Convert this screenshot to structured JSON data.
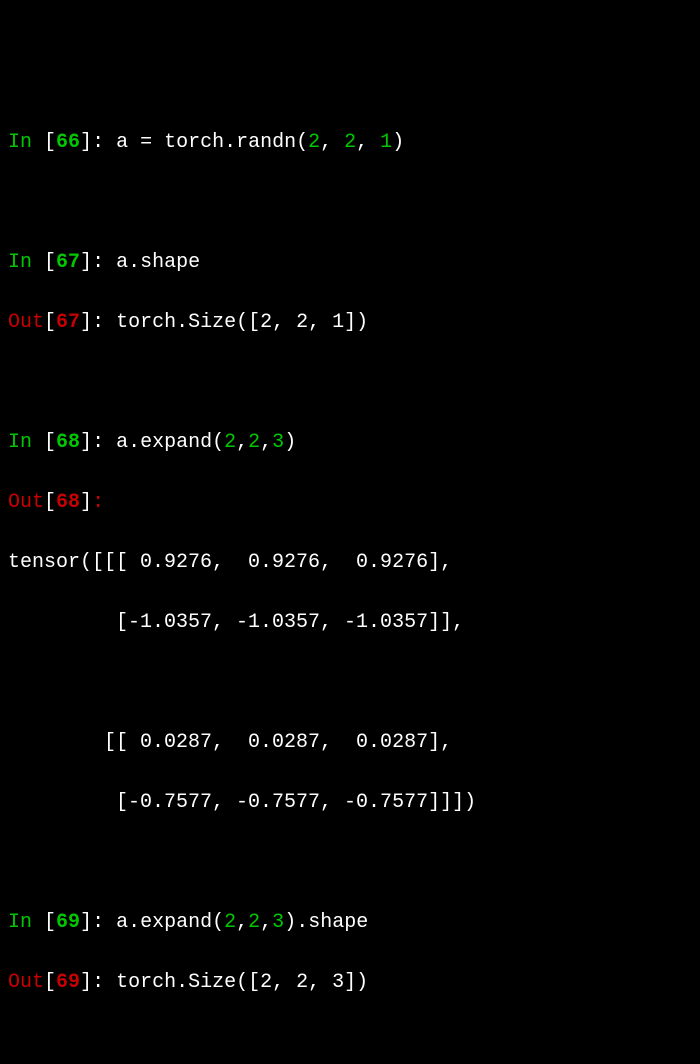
{
  "cells": [
    {
      "in_num": "66",
      "in_prefix": "In ",
      "out_prefix": "Out",
      "code_parts": [
        "a = torch.randn(",
        "2",
        ", ",
        "2",
        ", ",
        "1",
        ")"
      ]
    },
    {
      "in_num": "67",
      "code": "a.shape",
      "out_num": "67",
      "output": "torch.Size([2, 2, 1])"
    },
    {
      "in_num": "68",
      "code_parts": [
        "a.expand(",
        "2",
        ",",
        "2",
        ",",
        "3",
        ")"
      ],
      "out_num": "68",
      "output_lines": [
        "tensor([[[ 0.9276,  0.9276,  0.9276],",
        "         [-1.0357, -1.0357, -1.0357]],",
        "",
        "        [[ 0.0287,  0.0287,  0.0287],",
        "         [-0.7577, -0.7577, -0.7577]]])"
      ]
    },
    {
      "in_num": "69",
      "code_parts": [
        "a.expand(",
        "2",
        ",",
        "2",
        ",",
        "3",
        ").shape"
      ],
      "out_num": "69",
      "output": "torch.Size([2, 2, 3])"
    }
  ],
  "labels": {
    "in": "In ",
    "out": "Out",
    "colon": ": ",
    "lb": "[",
    "rb": "]"
  }
}
